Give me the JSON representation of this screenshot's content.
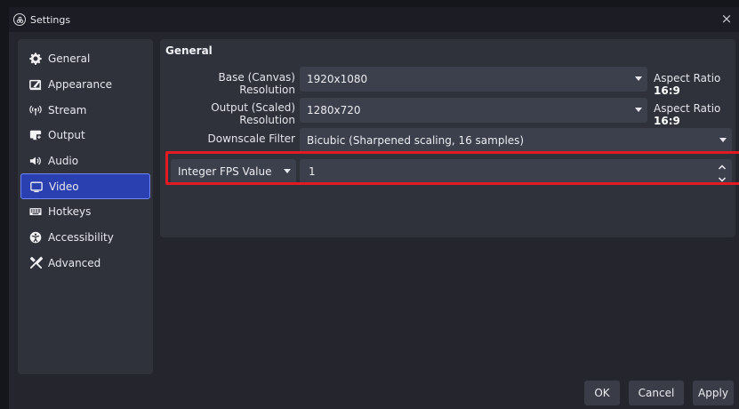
{
  "window": {
    "title": "Settings",
    "close_glyph": "×"
  },
  "sidebar": {
    "items": [
      {
        "label": "General",
        "icon": "gear-icon"
      },
      {
        "label": "Appearance",
        "icon": "appearance-icon"
      },
      {
        "label": "Stream",
        "icon": "broadcast-icon"
      },
      {
        "label": "Output",
        "icon": "output-icon"
      },
      {
        "label": "Audio",
        "icon": "speaker-icon"
      },
      {
        "label": "Video",
        "icon": "monitor-icon",
        "active": true
      },
      {
        "label": "Hotkeys",
        "icon": "keyboard-icon"
      },
      {
        "label": "Accessibility",
        "icon": "accessibility-icon"
      },
      {
        "label": "Advanced",
        "icon": "tools-icon"
      }
    ]
  },
  "general": {
    "title": "General",
    "base_resolution": {
      "label": "Base (Canvas) Resolution",
      "value": "1920x1080",
      "aspect_prefix": "Aspect Ratio",
      "aspect_value": "16:9"
    },
    "output_resolution": {
      "label": "Output (Scaled) Resolution",
      "value": "1280x720",
      "aspect_prefix": "Aspect Ratio",
      "aspect_value": "16:9"
    },
    "downscale_filter": {
      "label": "Downscale Filter",
      "value": "Bicubic (Sharpened scaling, 16 samples)"
    },
    "fps": {
      "type_value": "Integer FPS Value",
      "value": "1"
    }
  },
  "footer": {
    "ok_label": "OK",
    "cancel_label": "Cancel",
    "apply_label": "Apply"
  },
  "colors": {
    "active_item": "#2a3fb0",
    "highlight_border": "#e21b22"
  }
}
